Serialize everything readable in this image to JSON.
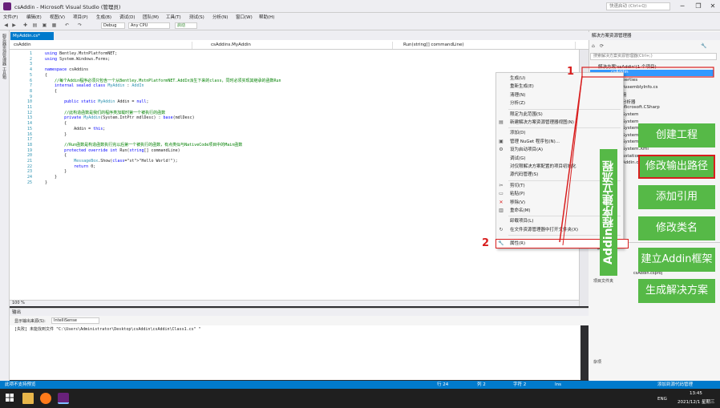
{
  "window": {
    "title": "csAddin - Microsoft Visual Studio (管理员)",
    "quick_launch_placeholder": "快速启动 (Ctrl+Q)"
  },
  "menu": [
    "文件(F)",
    "编辑(E)",
    "视图(V)",
    "项目(P)",
    "生成(B)",
    "调试(D)",
    "团队(M)",
    "工具(T)",
    "测试(S)",
    "分析(N)",
    "窗口(W)",
    "帮助(H)"
  ],
  "toolbar": {
    "config": "Debug",
    "platform": "Any CPU",
    "start": "启动"
  },
  "left_strip_label": "服务器资源管理器 工具箱",
  "editor": {
    "tab": "MyAddin.cs*",
    "nav_project": "csAddin",
    "nav_class": "csAddins.MyAddin",
    "nav_member": "Run(string[] commandLine)",
    "zoom": "100 %",
    "lines": [
      {
        "n": "1",
        "text": "using Bentley.MstnPlatformNET;"
      },
      {
        "n": "2",
        "text": "using System.Windows.Forms;"
      },
      {
        "n": "3",
        "text": ""
      },
      {
        "n": "4",
        "text": "namespace csAddins"
      },
      {
        "n": "5",
        "text": "{"
      },
      {
        "n": "6",
        "text": "    //每个Addin程序必须只包含一个从Bentley.MstnPlatformNET.AddIn派生下来的class，同时必须实现其继承的函数Run"
      },
      {
        "n": "7",
        "text": "    internal sealed class MyAddin : AddIn"
      },
      {
        "n": "8",
        "text": "    {"
      },
      {
        "n": "9",
        "text": ""
      },
      {
        "n": "10",
        "text": "        public static MyAddin Addin = null;"
      },
      {
        "n": "11",
        "text": ""
      },
      {
        "n": "12",
        "text": "        //此构造函数是我们的程序类加载时第一个被执行的函数"
      },
      {
        "n": "13",
        "text": "        private MyAddin(System.IntPtr mdlDesc) : base(mdlDesc)"
      },
      {
        "n": "14",
        "text": "        {"
      },
      {
        "n": "15",
        "text": "            Addin = this;"
      },
      {
        "n": "16",
        "text": "        }"
      },
      {
        "n": "17",
        "text": ""
      },
      {
        "n": "18",
        "text": "        //Run函数是构造函数执行完以后第一个被执行的函数，有点类似与NativeCode项目中的Main函数"
      },
      {
        "n": "19",
        "text": "        protected override int Run(string[] commandLine)"
      },
      {
        "n": "20",
        "text": "        {"
      },
      {
        "n": "21",
        "text": "            MessageBox.Show(\"Hello World!\");"
      },
      {
        "n": "22",
        "text": "            return 0;"
      },
      {
        "n": "23",
        "text": "        }"
      },
      {
        "n": "24",
        "text": "    }"
      },
      {
        "n": "25",
        "text": "}"
      }
    ]
  },
  "output": {
    "header": "输出",
    "source_label": "显示输出来源(S):",
    "source_value": "IntelliSense",
    "text": "[失败] 未能找到文件 \"C:\\Users\\Administrator\\Desktop\\csAddin\\csAddin\\Class1.cs\" \""
  },
  "statusbar": {
    "left": "此项不支持预览",
    "row": "行 24",
    "col": "列 2",
    "ch": "字符 2",
    "ins": "Ins",
    "right": "添加到源代码管理"
  },
  "solution_explorer": {
    "title": "解决方案资源管理器",
    "search_placeholder": "搜索解决方案资源管理器(Ctrl+;)",
    "solution_row": "解决方案'csAddin'(1 个项目)",
    "project_row": "csAddin",
    "items": [
      "perties",
      "AssemblyInfo.cs",
      "用",
      "分析器",
      "Microsoft.CSharp",
      "System",
      "System",
      "System",
      "System",
      "System.Windows.Forms",
      "System.Xml",
      "ustation",
      "Addin.cs"
    ]
  },
  "properties": {
    "header": "属性",
    "value": "csAddin.csproj",
    "footer": "项目文件夹",
    "desc": "杂项"
  },
  "context_menu": [
    {
      "label": "生成(U)",
      "icon": ""
    },
    {
      "label": "重新生成(E)",
      "icon": ""
    },
    {
      "label": "清理(N)",
      "icon": ""
    },
    {
      "label": "分析(Z)",
      "icon": ""
    },
    {
      "sep": true
    },
    {
      "label": "限定为此范围(S)",
      "icon": ""
    },
    {
      "label": "新建解决方案资源管理器视图(N)",
      "icon": "view-icon"
    },
    {
      "sep": true
    },
    {
      "label": "添加(D)",
      "icon": ""
    },
    {
      "label": "管理 NuGet 程序包(N)...",
      "icon": "nuget-icon"
    },
    {
      "label": "设为启动项目(A)",
      "icon": "gear-icon"
    },
    {
      "label": "调试(G)",
      "icon": ""
    },
    {
      "label": "对仅限解决方案配置的项目初始化",
      "icon": ""
    },
    {
      "label": "源代码管理(S)",
      "icon": ""
    },
    {
      "sep": true
    },
    {
      "label": "剪切(T)",
      "icon": "cut-icon"
    },
    {
      "label": "粘贴(P)",
      "icon": "paste-icon"
    },
    {
      "label": "移除(V)",
      "icon": "remove-icon"
    },
    {
      "label": "重命名(M)",
      "icon": "rename-icon"
    },
    {
      "sep": true
    },
    {
      "label": "卸载项目(L)",
      "icon": ""
    },
    {
      "label": "在文件资源管理器中打开文件夹(X)",
      "icon": "folder-icon"
    },
    {
      "sep": true
    },
    {
      "label": "属性(R)",
      "icon": "wrench-icon"
    }
  ],
  "annotations": {
    "title": "Addin程序建立流程",
    "num1": "1",
    "num2": "2",
    "steps": [
      "创建工程",
      "修改输出路径",
      "添加引用",
      "修改类名",
      "建立Addin框架",
      "生成解决方案"
    ]
  },
  "taskbar": {
    "lang": "ENG",
    "time": "13:45",
    "date": "2021/12/1 星期三"
  },
  "colors": {
    "accent": "#007acc",
    "annotation_green": "#56b947",
    "annotation_red": "#d81e1e"
  }
}
